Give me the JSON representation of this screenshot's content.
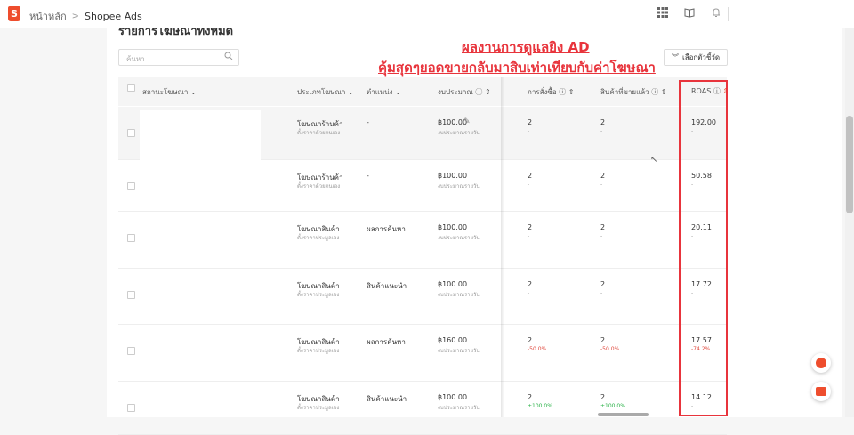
{
  "topbar": {
    "logo": "S",
    "breadcrumb": [
      "หน้าหลัก",
      "Shopee Ads"
    ],
    "icons": [
      "apps-grid-icon",
      "book-icon",
      "bell-icon"
    ]
  },
  "section_title": "รายการโฆษณาทั้งหมด",
  "search": {
    "placeholder": "ค้นหา"
  },
  "choose_metrics_label": "เลือกตัวชี้วัด",
  "annotation": {
    "line1": "ผลงานการดูแลยิง AD",
    "line2": "คุ้มสุดๆยอดขายกลับมาสิบเท่าเทียบกับค่าโฆษณา",
    "color": "#e8343c"
  },
  "table": {
    "headers": {
      "status": "สถานะโฆษณา",
      "type": "ประเภทโฆษณา",
      "position": "ตำแหน่ง",
      "budget": "งบประมาณ",
      "orders": "การสั่งซื้อ",
      "items_sold": "สินค้าที่ขายแล้ว",
      "roas": "ROAS"
    },
    "rows": [
      {
        "type": "โฆษณาร้านค้า",
        "type_sub": "ตั้งราคาด้วยตนเอง",
        "position": "-",
        "budget": "฿100.00",
        "budget_sub": "งบประมาณรายวัน",
        "orders": "2",
        "orders_change": "-",
        "items": "2",
        "items_change": "-",
        "roas": "192.00",
        "roas_change": "-"
      },
      {
        "type": "โฆษณาร้านค้า",
        "type_sub": "ตั้งราคาด้วยตนเอง",
        "position": "-",
        "budget": "฿100.00",
        "budget_sub": "งบประมาณรายวัน",
        "orders": "2",
        "orders_change": "-",
        "items": "2",
        "items_change": "-",
        "roas": "50.58",
        "roas_change": "-"
      },
      {
        "type": "โฆษณาสินค้า",
        "type_sub": "ตั้งราคาประมูลเอง",
        "position": "ผลการค้นหา",
        "budget": "฿100.00",
        "budget_sub": "งบประมาณรายวัน",
        "orders": "2",
        "orders_change": "-",
        "items": "2",
        "items_change": "-",
        "roas": "20.11",
        "roas_change": "-"
      },
      {
        "type": "โฆษณาสินค้า",
        "type_sub": "ตั้งราคาประมูลเอง",
        "position": "สินค้าแนะนำ",
        "budget": "฿100.00",
        "budget_sub": "งบประมาณรายวัน",
        "orders": "2",
        "orders_change": "-",
        "items": "2",
        "items_change": "-",
        "roas": "17.72",
        "roas_change": "-"
      },
      {
        "type": "โฆษณาสินค้า",
        "type_sub": "ตั้งราคาประมูลเอง",
        "position": "ผลการค้นหา",
        "budget": "฿160.00",
        "budget_sub": "งบประมาณรายวัน",
        "orders": "2",
        "orders_change": "-50.0%",
        "items": "2",
        "items_change": "-50.0%",
        "roas": "17.57",
        "roas_change": "-74.2%"
      },
      {
        "type": "โฆษณาสินค้า",
        "type_sub": "ตั้งราคาประมูลเอง",
        "position": "สินค้าแนะนำ",
        "budget": "฿100.00",
        "budget_sub": "งบประมาณรายวัน",
        "orders": "2",
        "orders_change": "+100.0%",
        "items": "2",
        "items_change": "+100.0%",
        "roas": "14.12",
        "roas_change": "-"
      }
    ]
  }
}
